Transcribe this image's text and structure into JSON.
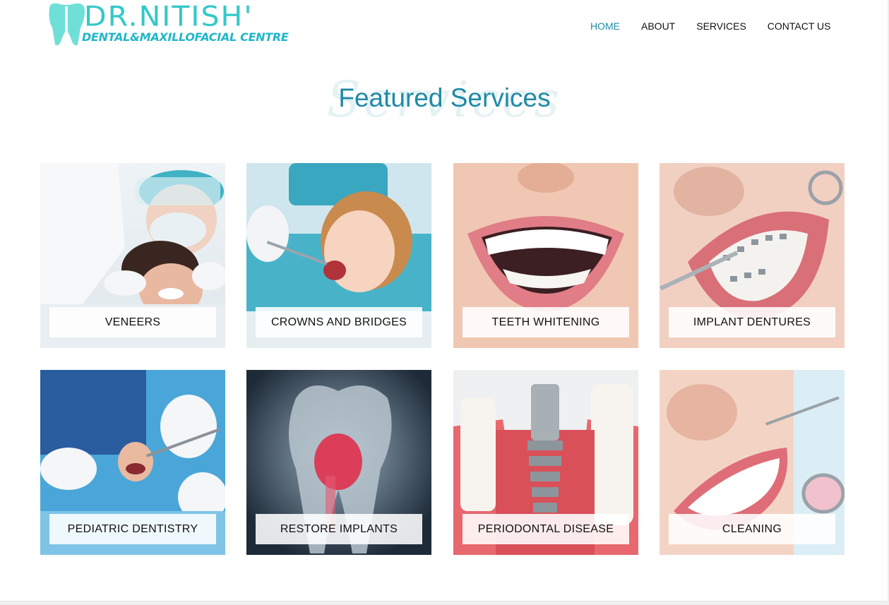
{
  "header": {
    "logo": {
      "title": "DR.NITISH'",
      "subtitle": "DENTAL&MAXILLOFACIAL CENTRE"
    },
    "nav": [
      {
        "label": "HOME",
        "active": true
      },
      {
        "label": "ABOUT",
        "active": false
      },
      {
        "label": "SERVICES",
        "active": false
      },
      {
        "label": "CONTACT US",
        "active": false
      }
    ]
  },
  "section": {
    "title": "Featured Services",
    "script_watermark": "Services"
  },
  "services": [
    {
      "label": "VENEERS",
      "image": "dentist-examining-woman-photo"
    },
    {
      "label": "CROWNS AND BRIDGES",
      "image": "child-dental-checkup-photo"
    },
    {
      "label": "TEETH WHITENING",
      "image": "white-smile-photo"
    },
    {
      "label": "IMPLANT DENTURES",
      "image": "braces-teeth-photo"
    },
    {
      "label": "PEDIATRIC DENTISTRY",
      "image": "child-dental-treatment-photo"
    },
    {
      "label": "RESTORE IMPLANTS",
      "image": "tooth-xray-photo"
    },
    {
      "label": "PERIODONTAL DISEASE",
      "image": "dental-implant-model-photo"
    },
    {
      "label": "CLEANING",
      "image": "teeth-cleaning-photo"
    }
  ],
  "colors": {
    "accent": "#1f8aa6",
    "logo_cyan": "#33c8c8",
    "label_bg": "#ffffff"
  }
}
